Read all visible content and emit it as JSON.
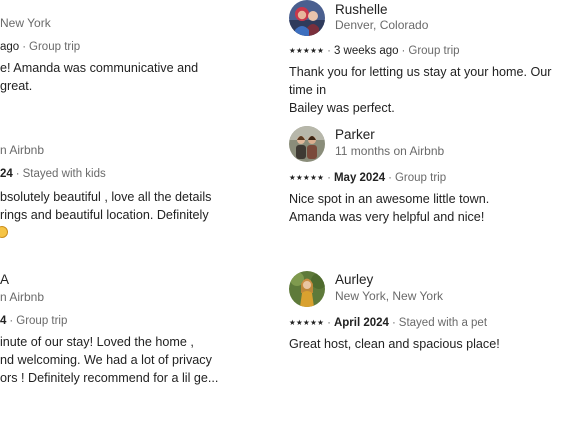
{
  "left_column": [
    {
      "subline": "New York",
      "meta": {
        "date": "ago",
        "trip": "Group trip"
      },
      "text": "e! Amanda was communicative and\ngreat."
    },
    {
      "subline": "n Airbnb",
      "meta": {
        "date": "24",
        "trip": "Stayed with kids"
      },
      "text": "bsolutely beautiful , love all the details\nrings and beautiful location. Definitely"
    },
    {
      "name": "A",
      "subline": "n Airbnb",
      "meta": {
        "date": "4",
        "trip": "Group trip"
      },
      "text": "inute of our stay! Loved the home ,\nnd welcoming. We had a lot of privacy\nors ! Definitely recommend for a lil ge..."
    }
  ],
  "right_column": [
    {
      "name": "Rushelle",
      "subline": "Denver, Colorado",
      "stars": "★★★★★",
      "meta": {
        "date": "3 weeks ago",
        "trip": "Group trip"
      },
      "text": "Thank you for letting us stay at your home. Our time in\nBailey was perfect."
    },
    {
      "name": "Parker",
      "subline": "11 months on Airbnb",
      "stars": "★★★★★",
      "meta": {
        "date": "May 2024",
        "trip": "Group trip"
      },
      "text": "Nice spot in an awesome little town.\nAmanda was very helpful and nice!"
    },
    {
      "name": "Aurley",
      "subline": "New York, New York",
      "stars": "★★★★★",
      "meta": {
        "date": "April 2024",
        "trip": "Stayed with a pet"
      },
      "text": "Great host, clean and spacious place!"
    }
  ]
}
